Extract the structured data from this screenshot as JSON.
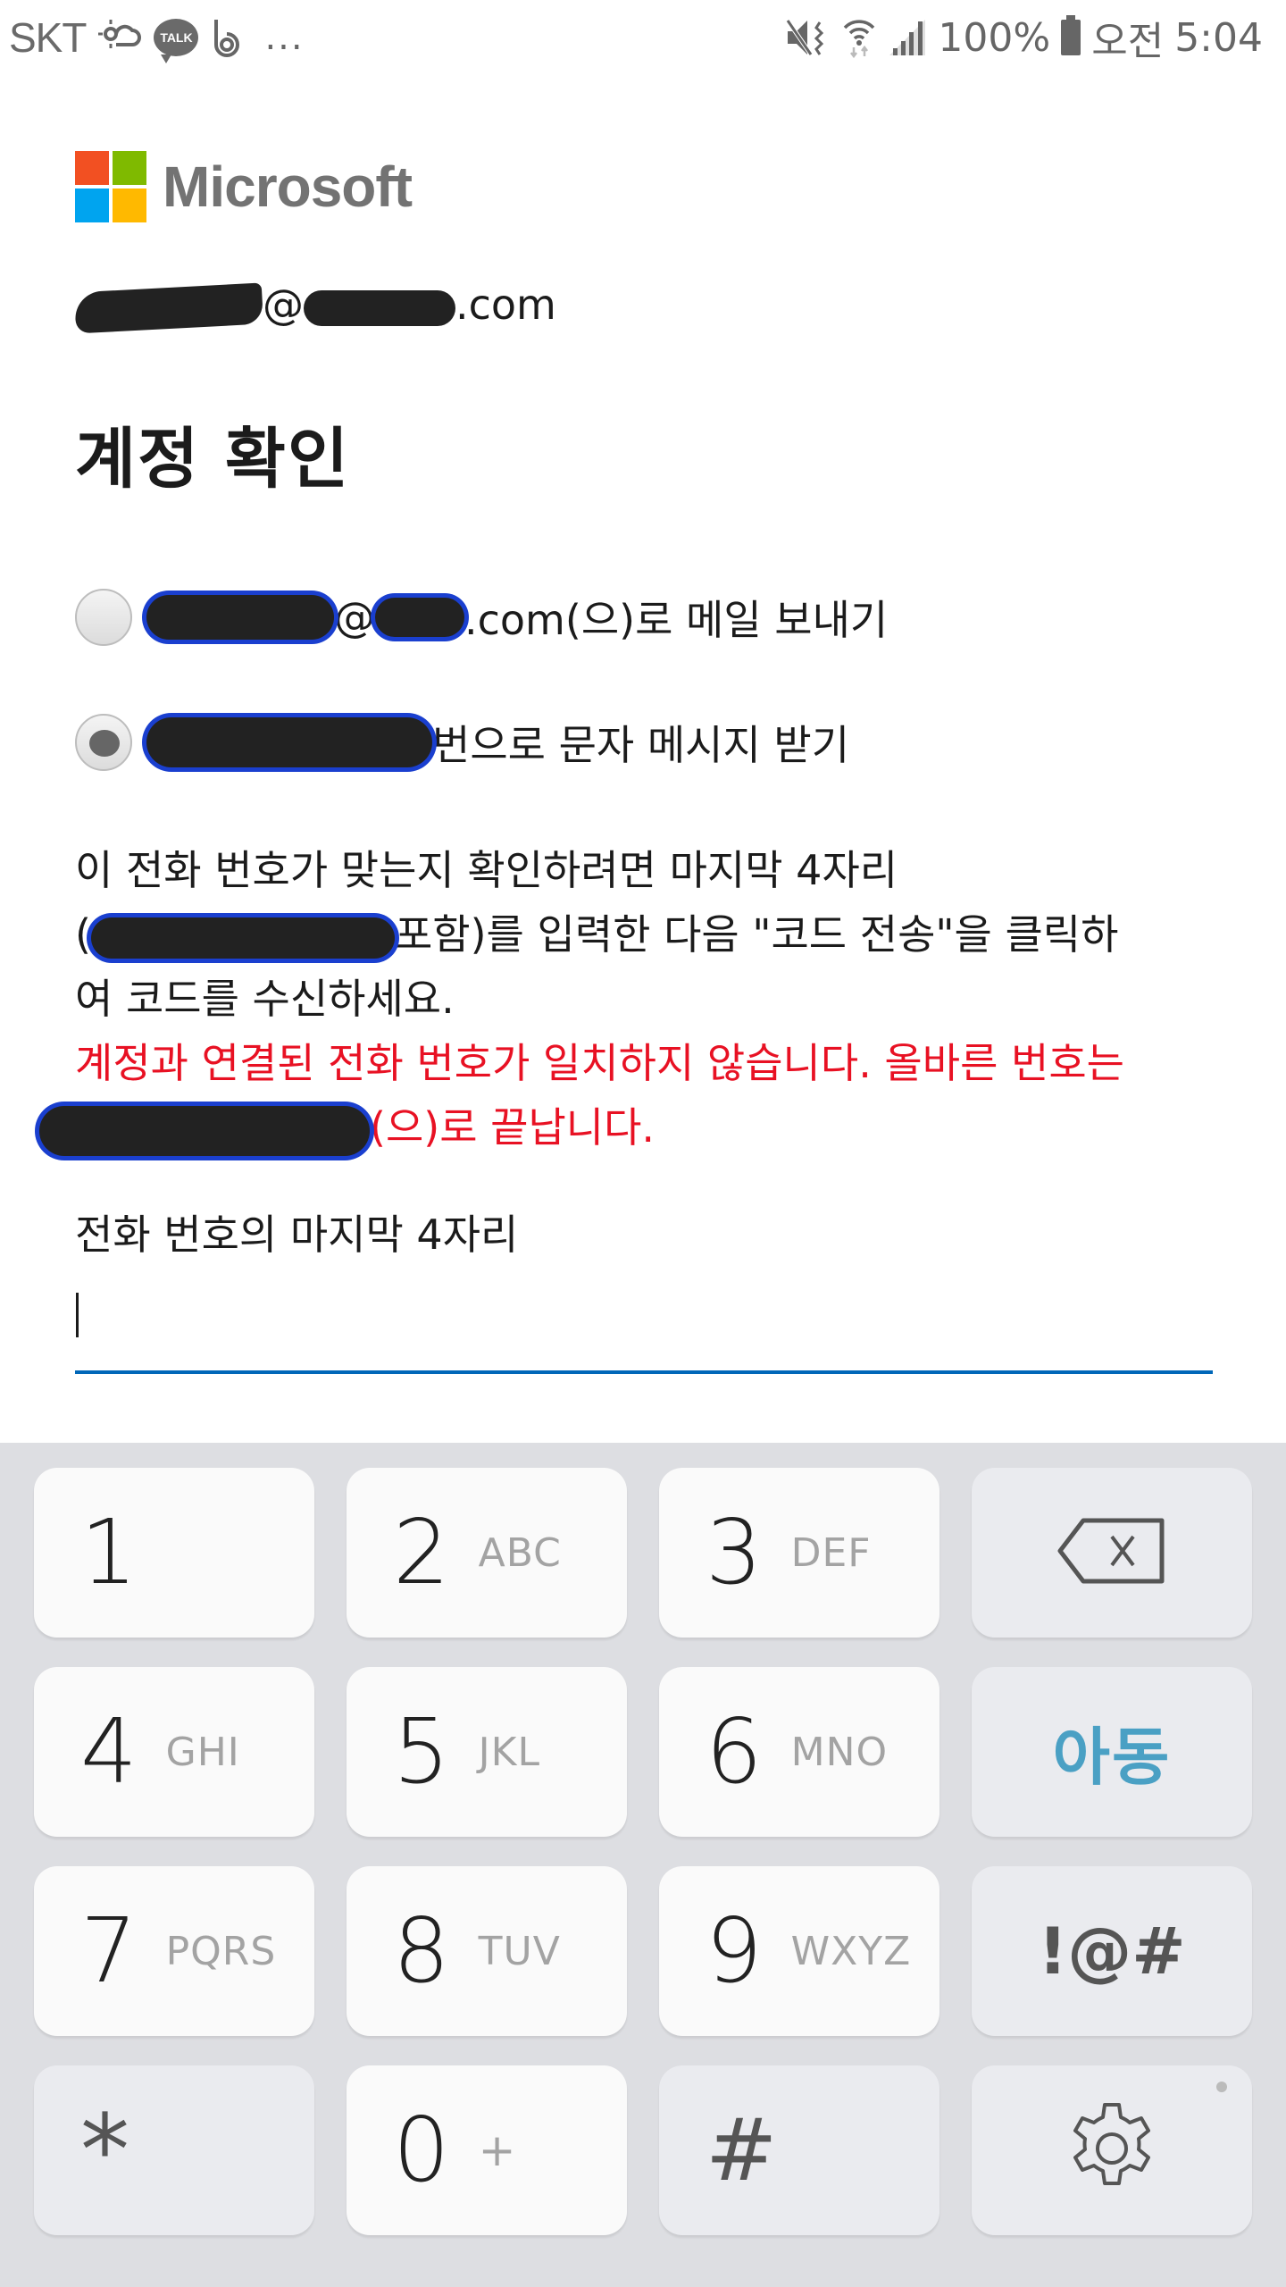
{
  "status_bar": {
    "carrier": "SKT",
    "left_icons": [
      "weather-cloud-icon",
      "kakaotalk-icon",
      "band-icon"
    ],
    "talk_label": "TALK",
    "more": "...",
    "right_icons": [
      "mute-vibrate-icon",
      "wifi-icon",
      "signal-icon"
    ],
    "battery": "100%",
    "ampm": "오전",
    "time": "5:04"
  },
  "brand": {
    "name": "Microsoft",
    "colors": [
      "#f25022",
      "#7fba00",
      "#00a4ef",
      "#ffb900"
    ]
  },
  "account": {
    "email_visible_parts": [
      "@",
      ".com"
    ]
  },
  "title": "계정 확인",
  "options": [
    {
      "label_suffix": ".com(으)로 메일 보내기",
      "label_mid": "@",
      "checked": false
    },
    {
      "label_suffix": "번으로 문자 메시지 받기",
      "checked": true
    }
  ],
  "instructions": {
    "line1": "이 전화 번호가 맞는지 확인하려면 마지막 4자리",
    "line2_open": "(",
    "line2_rest": "포함)를 입력한 다음 \"코드 전송\"을 클릭하",
    "line3": "여 코드를 수신하세요."
  },
  "error": {
    "line1": "계정과 연결된 전화 번호가 일치하지 않습니다. 올바른 번호는",
    "line2_rest": "(으)로 끝납니다.",
    "color": "#e81123"
  },
  "field": {
    "label": "전화 번호의 마지막 4자리",
    "value": "",
    "accent": "#0067b8"
  },
  "keypad": {
    "rows": [
      [
        {
          "digit": "1",
          "letters": ""
        },
        {
          "digit": "2",
          "letters": "ABC"
        },
        {
          "digit": "3",
          "letters": "DEF"
        },
        {
          "icon": "backspace-icon"
        }
      ],
      [
        {
          "digit": "4",
          "letters": "GHI"
        },
        {
          "digit": "5",
          "letters": "JKL"
        },
        {
          "digit": "6",
          "letters": "MNO"
        },
        {
          "label": "아동"
        }
      ],
      [
        {
          "digit": "7",
          "letters": "PQRS"
        },
        {
          "digit": "8",
          "letters": "TUV"
        },
        {
          "digit": "9",
          "letters": "WXYZ"
        },
        {
          "label": "!@#"
        }
      ],
      [
        {
          "label": "*"
        },
        {
          "digit": "0",
          "letters": "+"
        },
        {
          "label": "#"
        },
        {
          "icon": "gear-icon"
        }
      ]
    ]
  }
}
